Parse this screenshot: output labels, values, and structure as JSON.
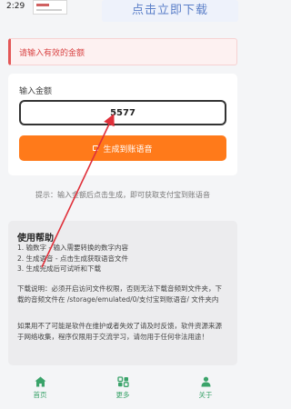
{
  "status_bar": {
    "time": "2:29"
  },
  "banner": {
    "text": "点击立即下载"
  },
  "error": {
    "message": "请输入有效的金额"
  },
  "form": {
    "label": "输入金额",
    "amount_value": "5577",
    "generate_label": "生成到账语音"
  },
  "hint": "提示：输入金额后点击生成，即可获取支付宝到账语音",
  "help": {
    "title": "使用帮助",
    "steps": [
      "1. 输数字 - 输入需要转换的数字内容",
      "2. 生成语音 - 点击生成获取语音文件",
      "3. 生成完成后可试听和下载"
    ],
    "note": "下载说明：必须开启访问文件权限，否则无法下载音频到文件夹，下载的音频文件在 /storage/emulated/0/支付宝到账语音/ 文件夹内",
    "disclaimer": "如果用不了可能是软件在维护或者失效了请及时反馈，软件资源来源于网络收集，程序仅限用于交流学习，请勿用于任何非法用途！"
  },
  "nav": {
    "items": [
      {
        "label": "首页",
        "icon": "home-icon"
      },
      {
        "label": "更多",
        "icon": "more-icon"
      },
      {
        "label": "关于",
        "icon": "about-icon"
      }
    ],
    "color": "#3aa36a"
  },
  "colors": {
    "accent": "#ff7a1a",
    "error": "#d94545",
    "annotation": "#e0303a"
  }
}
